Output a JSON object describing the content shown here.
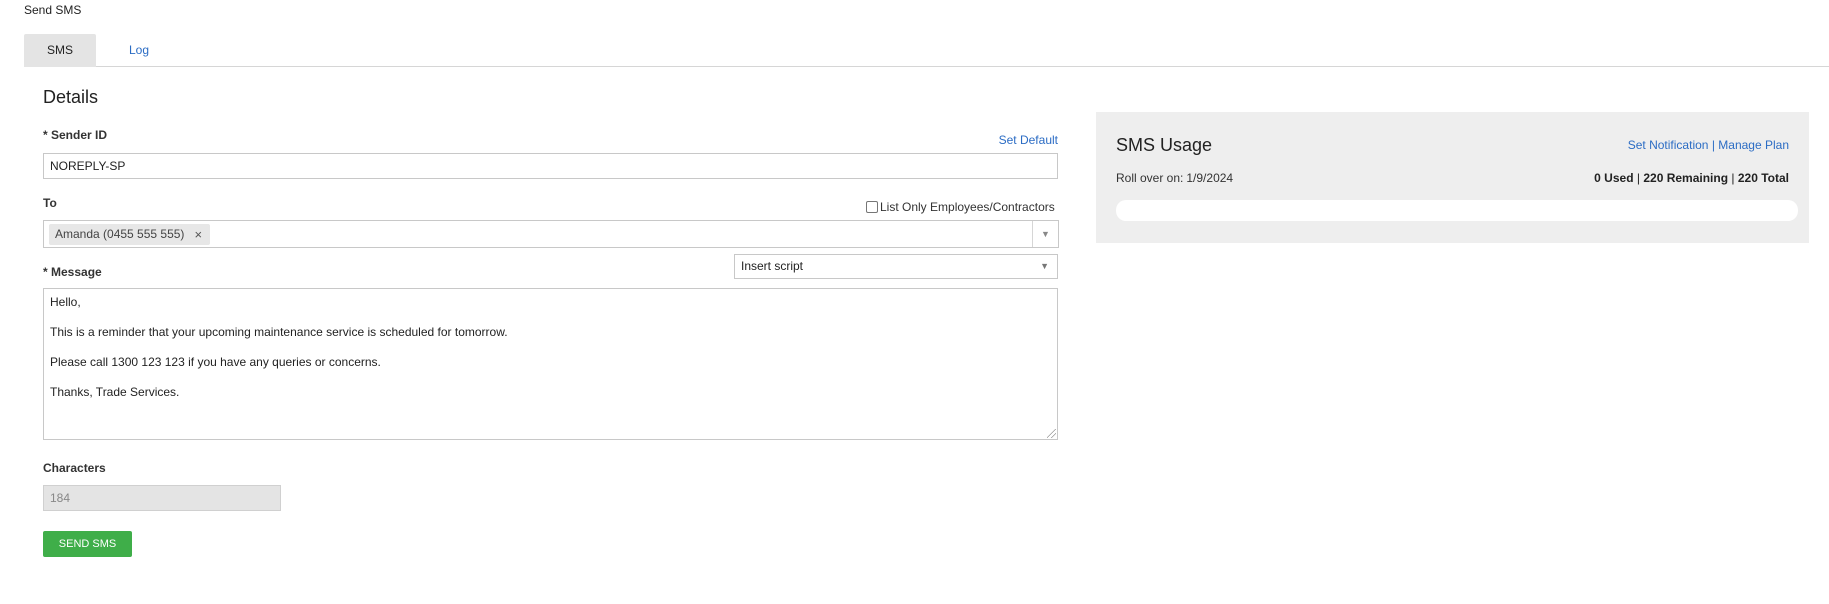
{
  "page": {
    "title": "Send SMS"
  },
  "tabs": [
    {
      "label": "SMS",
      "active": true
    },
    {
      "label": "Log",
      "active": false
    }
  ],
  "details": {
    "heading": "Details",
    "sender": {
      "label": "* Sender ID",
      "set_default": "Set Default",
      "value": "NOREPLY-SP"
    },
    "to": {
      "label": "To",
      "filter_checkbox_label": "List Only Employees/Contractors",
      "filter_checked": false,
      "recipients": [
        "Amanda (0455 555 555)"
      ]
    },
    "message": {
      "label": "* Message",
      "insert_script_value": "Insert script",
      "lines": [
        "Hello,",
        "This is a reminder that your upcoming maintenance service is scheduled for tomorrow.",
        "Please call 1300 123 123 if you have any queries or concerns.",
        "Thanks, Trade Services."
      ]
    },
    "characters": {
      "label": "Characters",
      "value": "184"
    },
    "send_button": "SEND SMS"
  },
  "usage": {
    "title": "SMS Usage",
    "set_notification": "Set Notification",
    "separator": "|",
    "manage_plan": "Manage Plan",
    "rollover_label": "Roll over on:",
    "rollover_date": "1/9/2024",
    "used": "0 Used",
    "remaining": "220 Remaining",
    "total": "220 Total",
    "progress_fraction": 0
  },
  "colors": {
    "link": "#2b6cc4",
    "button": "#3fae49",
    "panel": "#eeeeee"
  }
}
